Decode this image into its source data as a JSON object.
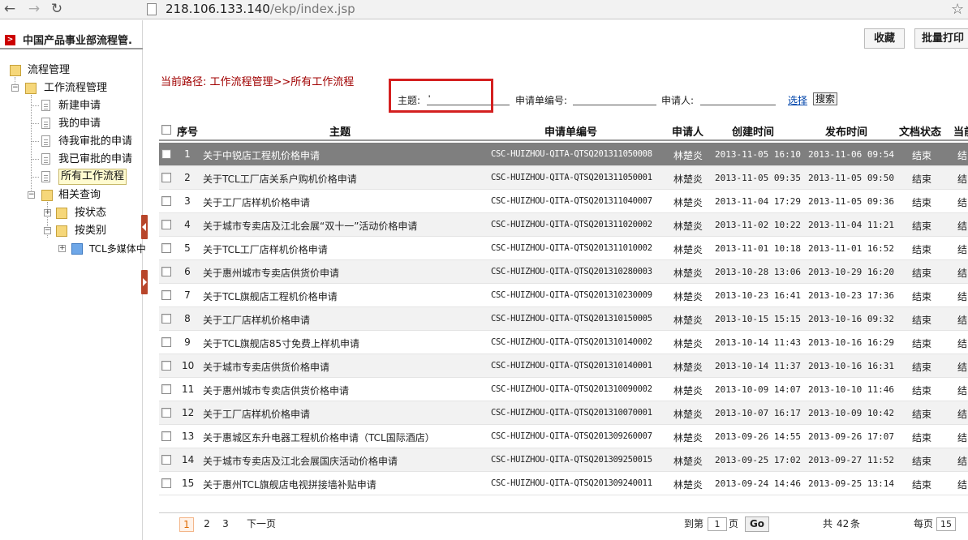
{
  "browser": {
    "url_host": "218.106.133.140",
    "url_path": "/ekp/index.jsp",
    "back_icon": "back-arrow-icon",
    "forward_icon": "forward-arrow-icon",
    "reload_icon": "reload-icon"
  },
  "sidebar": {
    "header_icon": ">",
    "header_title": "中国产品事业部流程管.",
    "tree": {
      "root": "流程管理",
      "workflow": "工作流程管理",
      "new_request": "新建申请",
      "my_requests": "我的申请",
      "pending": "待我审批的申请",
      "approved": "我已审批的申请",
      "all_workflows": "所有工作流程",
      "related_query": "相关查询",
      "by_status": "按状态",
      "by_category": "按类别",
      "tcl_media": "TCL多媒体中"
    }
  },
  "toolbar": {
    "favorite_label": "收藏",
    "batch_print_label": "批量打印"
  },
  "breadcrumb": "当前路径: 工作流程管理>>所有工作流程",
  "search": {
    "subject_label": "主题:",
    "subject_value": "'",
    "code_label": "申请单编号:",
    "code_value": "",
    "applicant_label": "申请人:",
    "applicant_value": "",
    "select_link": "选择",
    "search_button": "搜索"
  },
  "table": {
    "headers": {
      "no": "序号",
      "subject": "主题",
      "code": "申请单编号",
      "applicant": "申请人",
      "created": "创建时间",
      "published": "发布时间",
      "doc_status": "文档状态",
      "current": "当前"
    },
    "rows": [
      {
        "no": "1",
        "subject": "关于中锐店工程机价格申请",
        "code": "CSC-HUIZHOU-QITA-QTSQ201311050008",
        "applicant": "林楚炎",
        "created": "2013-11-05 16:10",
        "published": "2013-11-06 09:54",
        "status": "结束",
        "current": "结"
      },
      {
        "no": "2",
        "subject": "关于TCL工厂店关系户购机价格申请",
        "code": "CSC-HUIZHOU-QITA-QTSQ201311050001",
        "applicant": "林楚炎",
        "created": "2013-11-05 09:35",
        "published": "2013-11-05 09:50",
        "status": "结束",
        "current": "结"
      },
      {
        "no": "3",
        "subject": "关于工厂店样机价格申请",
        "code": "CSC-HUIZHOU-QITA-QTSQ201311040007",
        "applicant": "林楚炎",
        "created": "2013-11-04 17:29",
        "published": "2013-11-05 09:36",
        "status": "结束",
        "current": "结"
      },
      {
        "no": "4",
        "subject": "关于城市专卖店及江北会展“双十一”活动价格申请",
        "code": "CSC-HUIZHOU-QITA-QTSQ201311020002",
        "applicant": "林楚炎",
        "created": "2013-11-02 10:22",
        "published": "2013-11-04 11:21",
        "status": "结束",
        "current": "结"
      },
      {
        "no": "5",
        "subject": "关于TCL工厂店样机价格申请",
        "code": "CSC-HUIZHOU-QITA-QTSQ201311010002",
        "applicant": "林楚炎",
        "created": "2013-11-01 10:18",
        "published": "2013-11-01 16:52",
        "status": "结束",
        "current": "结"
      },
      {
        "no": "6",
        "subject": "关于惠州城市专卖店供货价申请",
        "code": "CSC-HUIZHOU-QITA-QTSQ201310280003",
        "applicant": "林楚炎",
        "created": "2013-10-28 13:06",
        "published": "2013-10-29 16:20",
        "status": "结束",
        "current": "结"
      },
      {
        "no": "7",
        "subject": "关于TCL旗舰店工程机价格申请",
        "code": "CSC-HUIZHOU-QITA-QTSQ201310230009",
        "applicant": "林楚炎",
        "created": "2013-10-23 16:41",
        "published": "2013-10-23 17:36",
        "status": "结束",
        "current": "结"
      },
      {
        "no": "8",
        "subject": "关于工厂店样机价格申请",
        "code": "CSC-HUIZHOU-QITA-QTSQ201310150005",
        "applicant": "林楚炎",
        "created": "2013-10-15 15:15",
        "published": "2013-10-16 09:32",
        "status": "结束",
        "current": "结"
      },
      {
        "no": "9",
        "subject": "关于TCL旗舰店85寸免费上样机申请",
        "code": "CSC-HUIZHOU-QITA-QTSQ201310140002",
        "applicant": "林楚炎",
        "created": "2013-10-14 11:43",
        "published": "2013-10-16 16:29",
        "status": "结束",
        "current": "结"
      },
      {
        "no": "10",
        "subject": "关于城市专卖店供货价格申请",
        "code": "CSC-HUIZHOU-QITA-QTSQ201310140001",
        "applicant": "林楚炎",
        "created": "2013-10-14 11:37",
        "published": "2013-10-16 16:31",
        "status": "结束",
        "current": "结"
      },
      {
        "no": "11",
        "subject": "关于惠州城市专卖店供货价格申请",
        "code": "CSC-HUIZHOU-QITA-QTSQ201310090002",
        "applicant": "林楚炎",
        "created": "2013-10-09 14:07",
        "published": "2013-10-10 11:46",
        "status": "结束",
        "current": "结"
      },
      {
        "no": "12",
        "subject": "关于工厂店样机价格申请",
        "code": "CSC-HUIZHOU-QITA-QTSQ201310070001",
        "applicant": "林楚炎",
        "created": "2013-10-07 16:17",
        "published": "2013-10-09 10:42",
        "status": "结束",
        "current": "结"
      },
      {
        "no": "13",
        "subject": "关于惠城区东升电器工程机价格申请（TCL国际酒店）",
        "code": "CSC-HUIZHOU-QITA-QTSQ201309260007",
        "applicant": "林楚炎",
        "created": "2013-09-26 14:55",
        "published": "2013-09-26 17:07",
        "status": "结束",
        "current": "结"
      },
      {
        "no": "14",
        "subject": "关于城市专卖店及江北会展国庆活动价格申请",
        "code": "CSC-HUIZHOU-QITA-QTSQ201309250015",
        "applicant": "林楚炎",
        "created": "2013-09-25 17:02",
        "published": "2013-09-27 11:52",
        "status": "结束",
        "current": "结"
      },
      {
        "no": "15",
        "subject": "关于惠州TCL旗舰店电视拼接墙补贴申请",
        "code": "CSC-HUIZHOU-QITA-QTSQ201309240011",
        "applicant": "林楚炎",
        "created": "2013-09-24 14:46",
        "published": "2013-09-25 13:14",
        "status": "结束",
        "current": "结"
      }
    ]
  },
  "pager": {
    "page1": "1",
    "page2": "2",
    "page3": "3",
    "next": "下一页",
    "goto_label": "到第",
    "goto_value": "1",
    "page_unit": "页",
    "go_button": "Go",
    "total_prefix": "共",
    "total": "42",
    "total_unit": "条",
    "per_page_label": "每页",
    "per_page_value": "15"
  }
}
